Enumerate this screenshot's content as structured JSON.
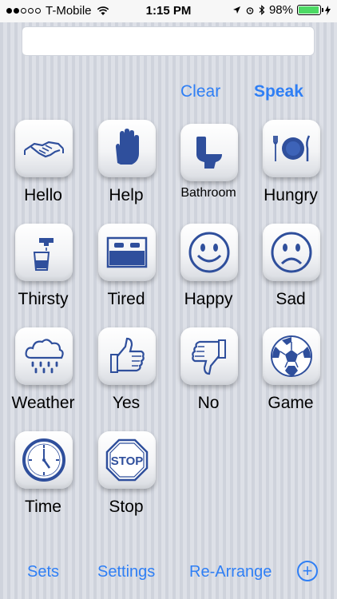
{
  "status_bar": {
    "carrier": "T-Mobile",
    "time": "1:15 PM",
    "battery": "98%"
  },
  "message_field": {
    "value": ""
  },
  "actions": {
    "clear": "Clear",
    "speak": "Speak"
  },
  "tiles": [
    {
      "label": "Hello",
      "icon": "handshake-icon"
    },
    {
      "label": "Help",
      "icon": "raised-hand-icon"
    },
    {
      "label": "Bathroom",
      "icon": "toilet-icon"
    },
    {
      "label": "Hungry",
      "icon": "plate-cutlery-icon"
    },
    {
      "label": "Thirsty",
      "icon": "faucet-glass-icon"
    },
    {
      "label": "Tired",
      "icon": "bed-icon"
    },
    {
      "label": "Happy",
      "icon": "smiley-icon"
    },
    {
      "label": "Sad",
      "icon": "sad-face-icon"
    },
    {
      "label": "Weather",
      "icon": "rain-cloud-icon"
    },
    {
      "label": "Yes",
      "icon": "thumbs-up-icon"
    },
    {
      "label": "No",
      "icon": "thumbs-down-icon"
    },
    {
      "label": "Game",
      "icon": "soccer-ball-icon"
    },
    {
      "label": "Time",
      "icon": "clock-icon"
    },
    {
      "label": "Stop",
      "icon": "stop-sign-icon"
    }
  ],
  "bottom_bar": {
    "sets": "Sets",
    "settings": "Settings",
    "rearrange": "Re-Arrange",
    "add": "+"
  },
  "colors": {
    "accent": "#2f7ff5",
    "icon_blue": "#2f4f9c"
  }
}
